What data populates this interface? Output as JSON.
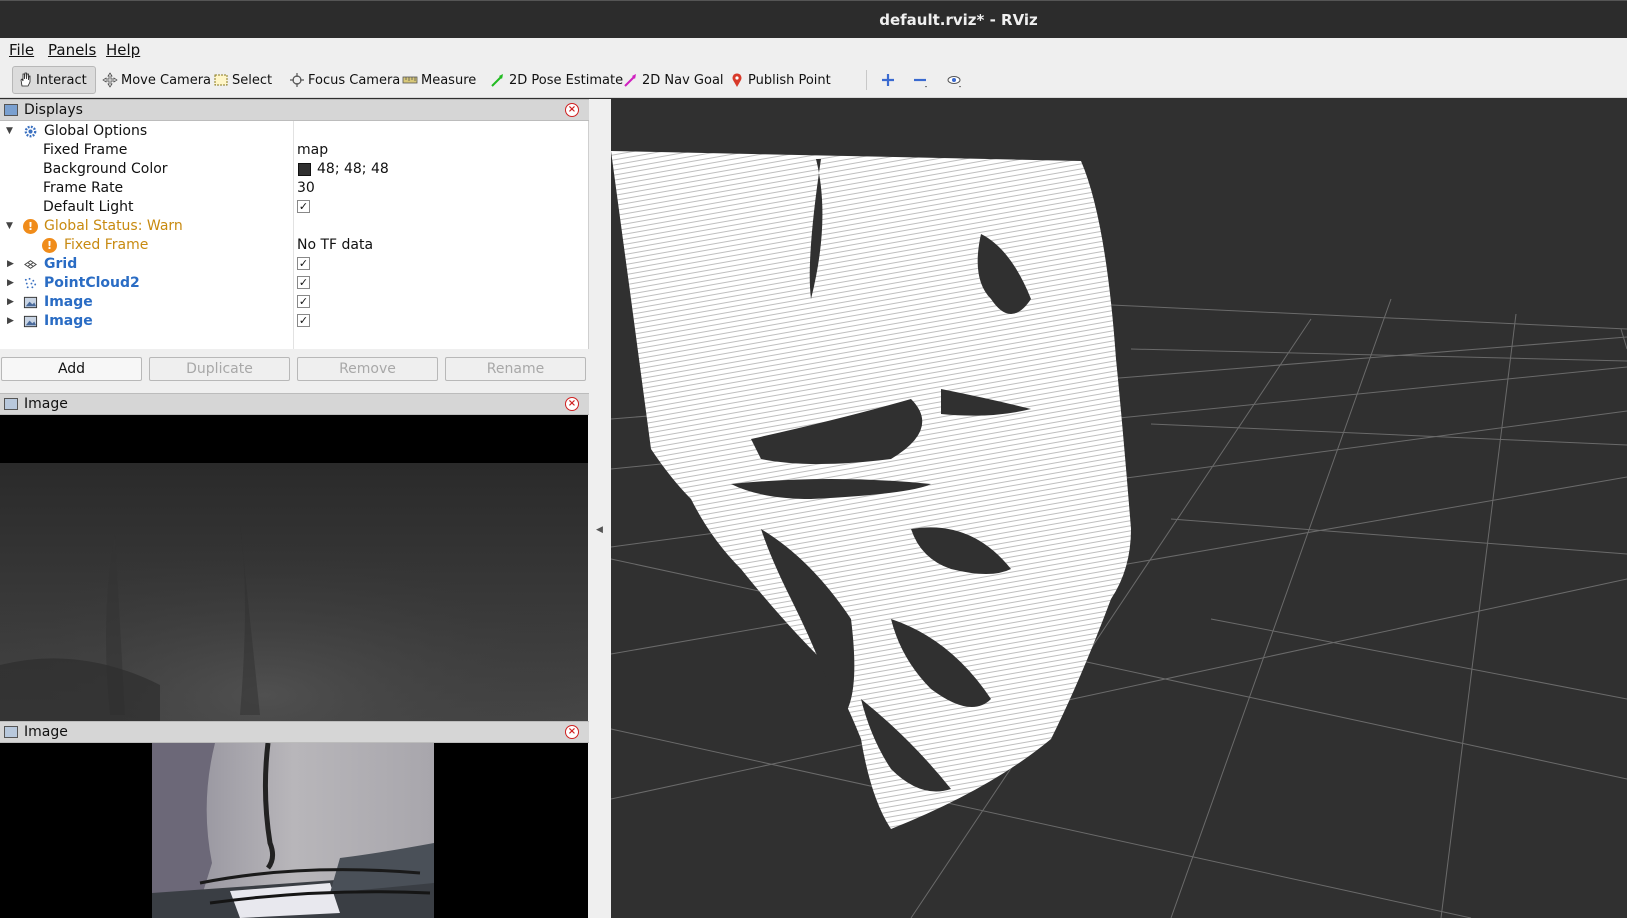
{
  "window": {
    "title": "default.rviz* - RViz"
  },
  "menu": {
    "items": [
      "File",
      "Panels",
      "Help"
    ]
  },
  "toolbar": {
    "interact": "Interact",
    "move_camera": "Move Camera",
    "select": "Select",
    "focus_camera": "Focus Camera",
    "measure": "Measure",
    "pose_estimate": "2D Pose Estimate",
    "nav_goal": "2D Nav Goal",
    "publish_point": "Publish Point",
    "icons": [
      "hand-icon",
      "move-camera-icon",
      "select-icon",
      "focus-camera-icon",
      "measure-icon",
      "pose-arrow-icon",
      "nav-goal-icon",
      "map-pin-icon",
      "plus-icon",
      "minus-icon",
      "eye-icon"
    ]
  },
  "displays": {
    "panel_title": "Displays",
    "global_options": "Global Options",
    "fixed_frame_label": "Fixed Frame",
    "fixed_frame_value": "map",
    "bg_color_label": "Background Color",
    "bg_color_value": "48; 48; 48",
    "bg_color_swatch": "#303030",
    "frame_rate_label": "Frame Rate",
    "frame_rate_value": "30",
    "default_light_label": "Default Light",
    "global_status": "Global Status: Warn",
    "status_fixed_frame": "Fixed Frame",
    "status_fixed_frame_value": "No TF data",
    "grid": "Grid",
    "pointcloud": "PointCloud2",
    "image1": "Image",
    "image2": "Image",
    "checked": "✓"
  },
  "buttons": {
    "add": "Add",
    "duplicate": "Duplicate",
    "remove": "Remove",
    "rename": "Rename"
  },
  "image_panels": {
    "depth_title": "Image",
    "rgb_title": "Image"
  },
  "colors": {
    "viewport_bg": "#303030",
    "warn": "#c88a10",
    "link_blue": "#2a6cc4"
  }
}
